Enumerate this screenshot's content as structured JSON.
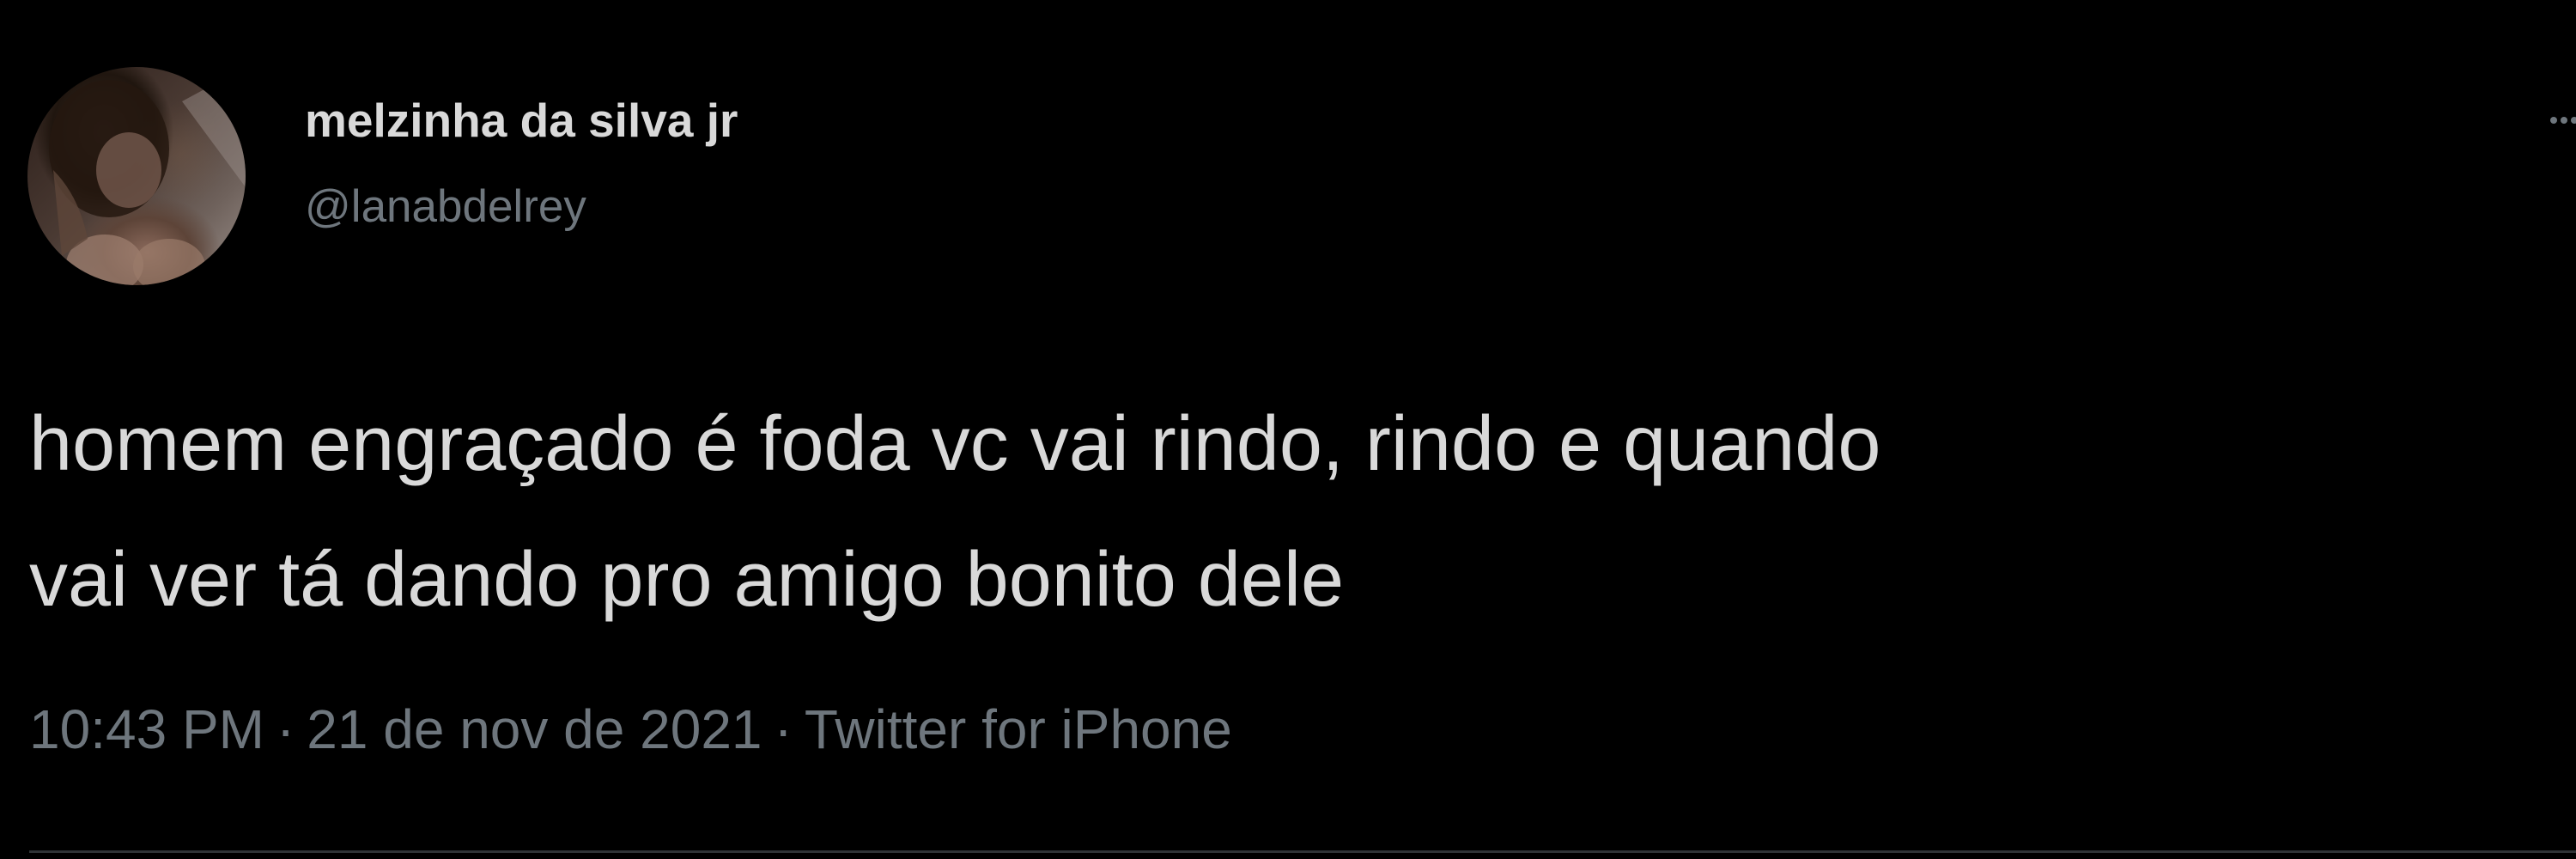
{
  "author": {
    "display_name": "melzinha da silva jr",
    "handle": "@lanabdelrey"
  },
  "tweet": {
    "text_line_1": "homem engraçado é foda vc vai rindo, rindo e quando",
    "text_line_2": "vai ver tá dando pro amigo bonito dele"
  },
  "meta": {
    "time": "10:43 PM",
    "separator": "·",
    "date": "21 de nov de 2021",
    "source": "Twitter for iPhone"
  },
  "icons": {
    "more": "more-options-icon",
    "avatar": "profile-avatar"
  },
  "colors": {
    "background": "#000000",
    "primary_text": "#d9d9d9",
    "secondary_text": "#6e767d",
    "divider": "#2f3336"
  }
}
